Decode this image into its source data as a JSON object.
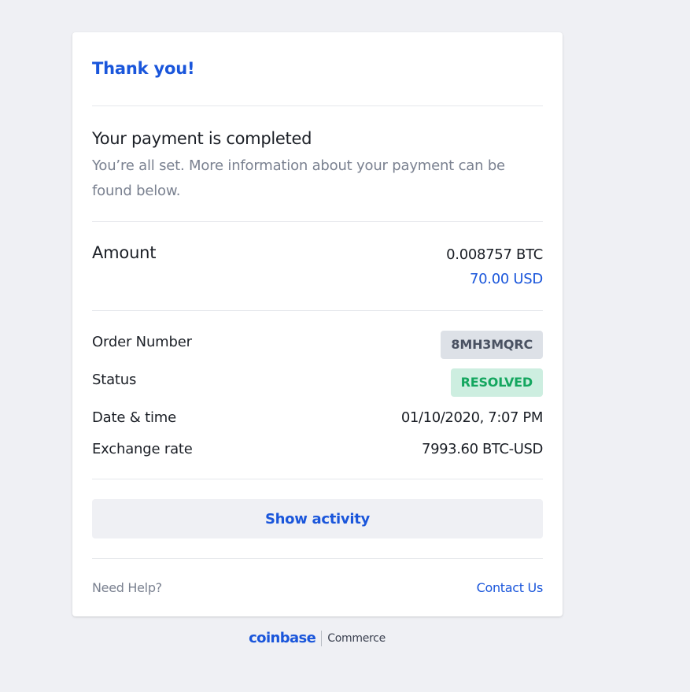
{
  "header": {
    "title": "Thank you!"
  },
  "message": {
    "heading": "Your payment is completed",
    "body": "You’re all set. More information about your payment can be found below."
  },
  "amount": {
    "label": "Amount",
    "crypto": "0.008757 BTC",
    "fiat": "70.00 USD"
  },
  "details": {
    "order_label": "Order Number",
    "order_value": "8MH3MQRC",
    "status_label": "Status",
    "status_value": "RESOLVED",
    "date_label": "Date & time",
    "date_value": "01/10/2020, 7:07 PM",
    "rate_label": "Exchange rate",
    "rate_value": "7993.60 BTC-USD"
  },
  "actions": {
    "show_activity": "Show activity"
  },
  "footer": {
    "help": "Need Help?",
    "contact": "Contact Us"
  },
  "brand": {
    "name": "coinbase",
    "product": "Commerce"
  },
  "colors": {
    "accent": "#1a56db",
    "status_text": "#14a65f",
    "status_bg": "#cdeee0",
    "page_bg": "#eff0f4"
  }
}
